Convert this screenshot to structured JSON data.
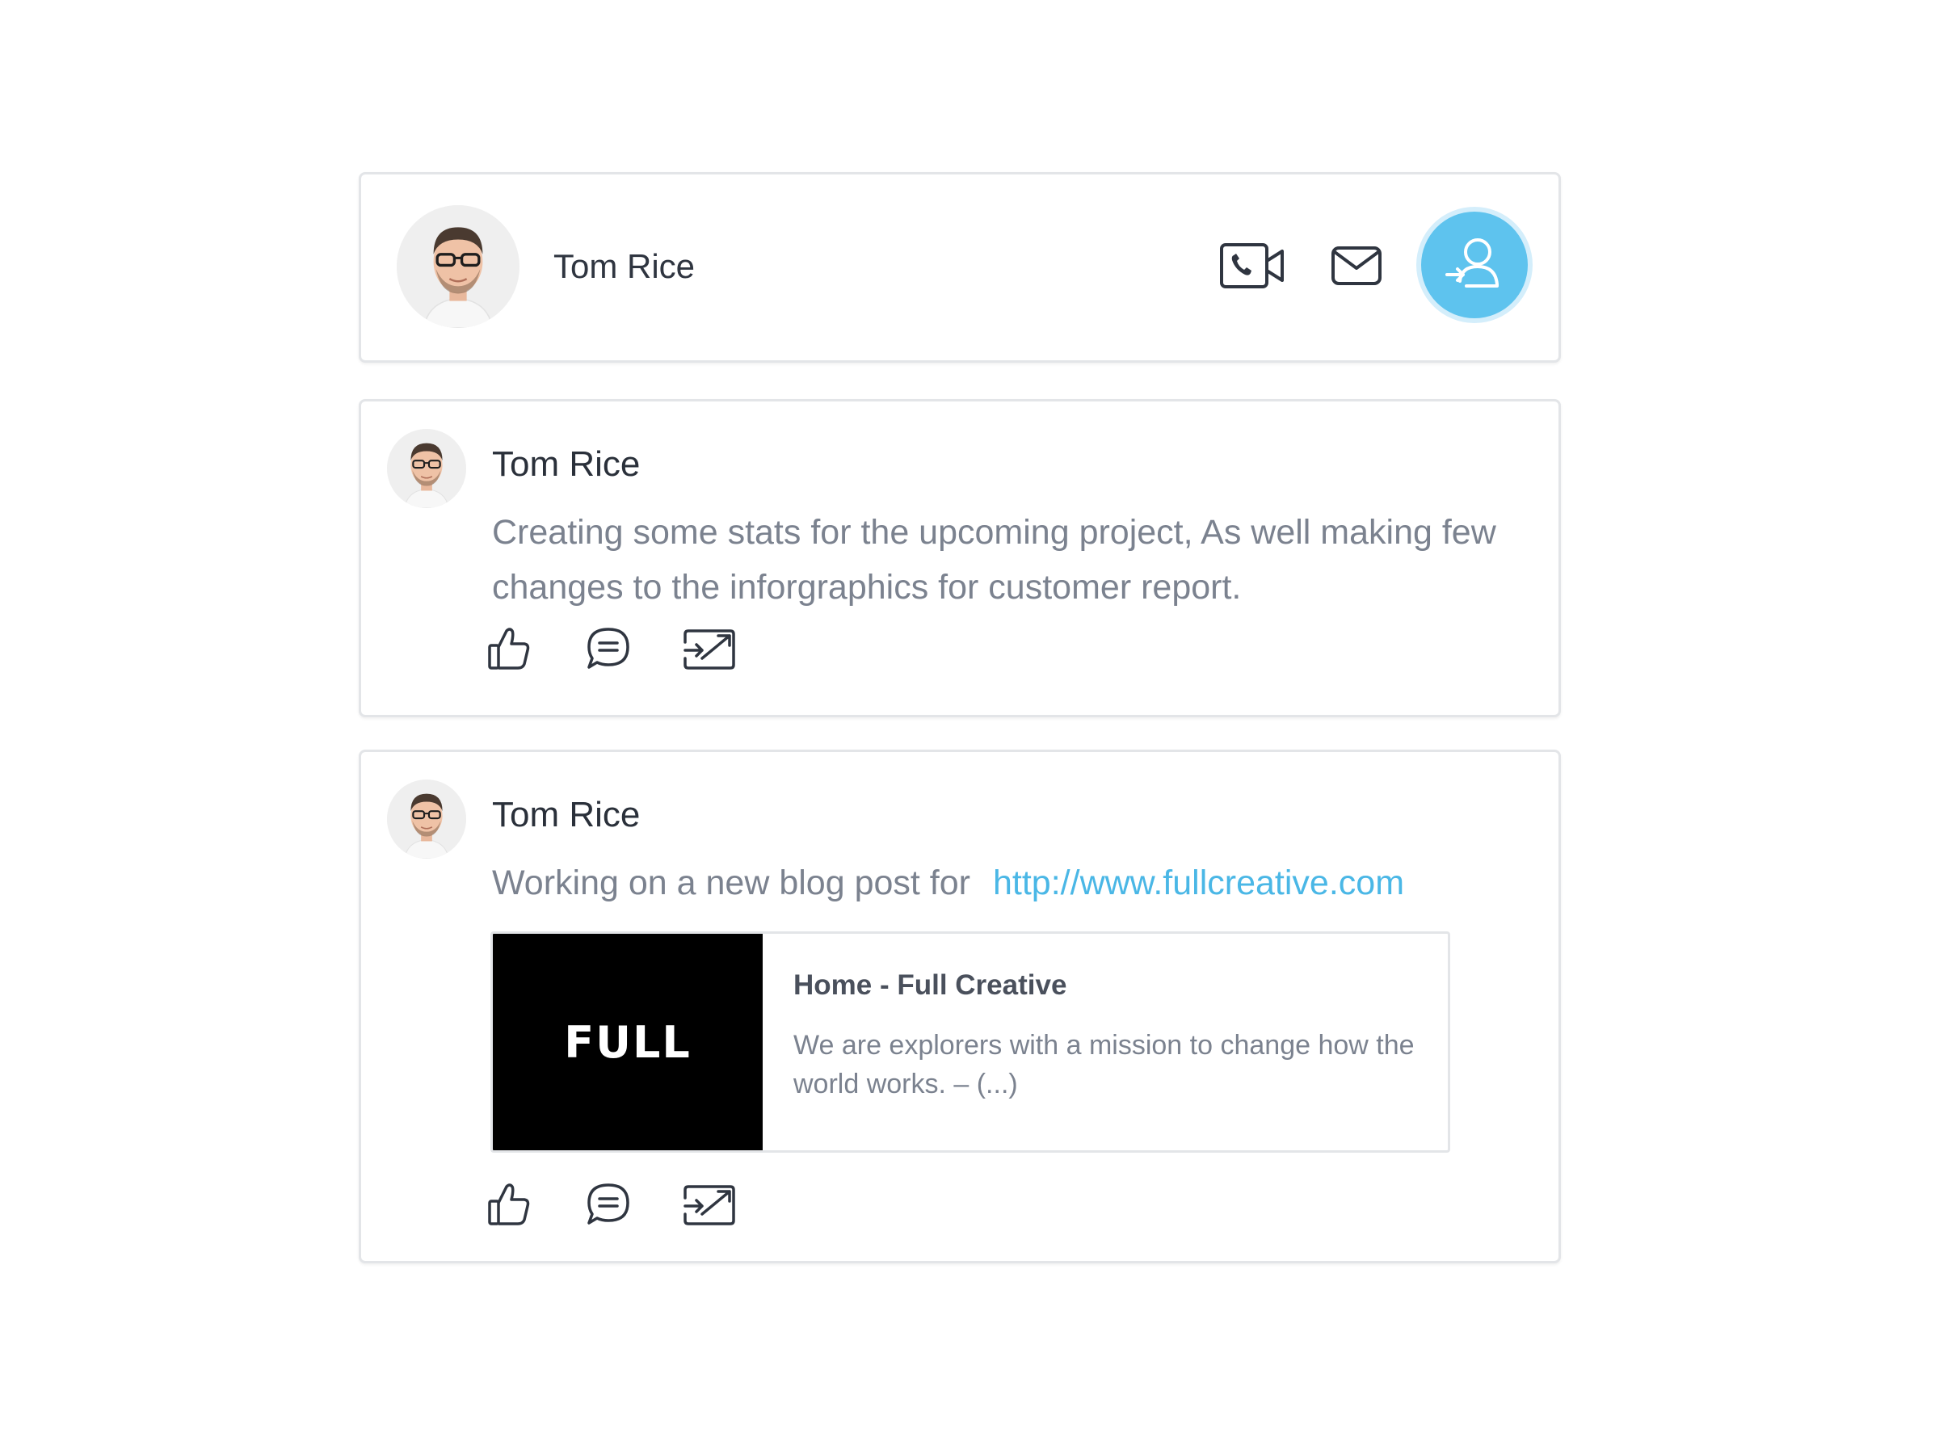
{
  "contact": {
    "name": "Tom Rice",
    "accent_color": "#5ec3ee"
  },
  "posts": [
    {
      "author": "Tom Rice",
      "text": "Creating some stats for the upcoming project, As well making few changes to the inforgraphics for customer report."
    },
    {
      "author": "Tom Rice",
      "text": "Working on a new blog post for",
      "link": "http://www.fullcreative.com",
      "preview": {
        "logo_text": "FULL",
        "title": "Home - Full Creative",
        "description": "We are explorers with a mission to change how the world works. – (...)"
      }
    }
  ],
  "icons": {
    "contact_actions": [
      "video-call-icon",
      "mail-icon",
      "add-contact-icon"
    ],
    "post_actions": [
      "like-icon",
      "comment-icon",
      "share-icon"
    ]
  }
}
